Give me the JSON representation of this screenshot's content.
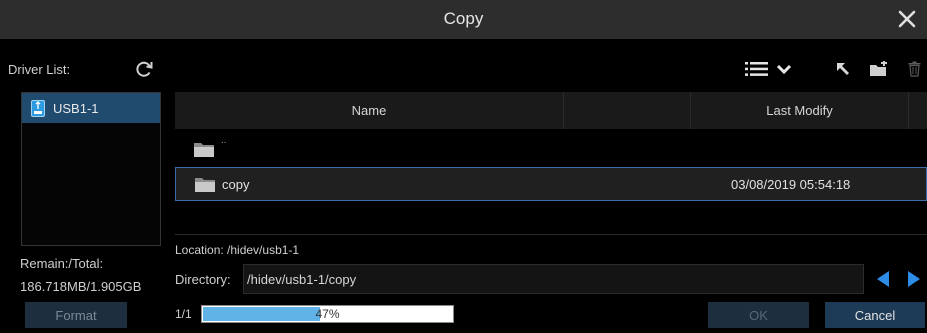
{
  "window": {
    "title": "Copy"
  },
  "sidebar": {
    "driver_list_label": "Driver List:",
    "drives": [
      {
        "name": "USB1-1"
      }
    ],
    "remain_label": "Remain:/Total:",
    "remain_value": "186.718MB/1.905GB",
    "format_label": "Format"
  },
  "table": {
    "headers": [
      "Name",
      "",
      "Last Modify",
      ""
    ],
    "rows": [
      {
        "name": "..",
        "modified": ""
      },
      {
        "name": "copy",
        "modified": "03/08/2019 05:54:18"
      }
    ]
  },
  "location_text": "Location: /hidev/usb1-1",
  "directory": {
    "label": "Directory:",
    "value": "/hidev/usb1-1/copy"
  },
  "footer": {
    "page": "1/1",
    "progress_percent": 47,
    "progress_text": "47%",
    "ok_label": "OK",
    "cancel_label": "Cancel"
  },
  "icons": {
    "close": "close-icon",
    "refresh": "refresh-icon",
    "list_view": "list-view-icon",
    "dropdown": "chevron-down-icon",
    "back": "back-arrow-icon",
    "new_folder": "new-folder-icon",
    "delete": "trash-icon",
    "prev": "arrow-left-icon",
    "next": "arrow-right-icon"
  },
  "colors": {
    "accent": "#2d8ce6",
    "selection": "#204a6e",
    "progress": "#5fb3e6"
  }
}
